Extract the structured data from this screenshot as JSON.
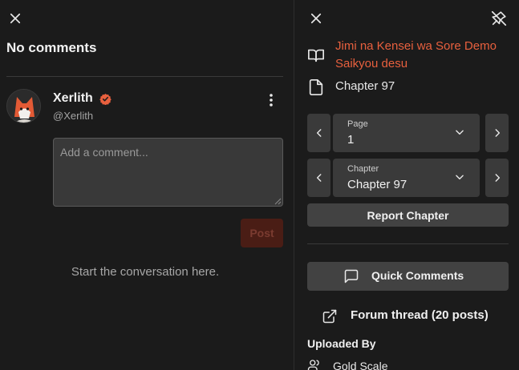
{
  "comments": {
    "heading": "No comments",
    "user": {
      "name": "Xerlith",
      "handle": "@Xerlith"
    },
    "input_placeholder": "Add a comment...",
    "post_label": "Post",
    "empty_message": "Start the conversation here."
  },
  "reader": {
    "manga_title": "Jimi na Kensei wa Sore Demo Saikyou desu",
    "chapter_label": "Chapter 97",
    "page_select": {
      "caption": "Page",
      "value": "1"
    },
    "chapter_select": {
      "caption": "Chapter",
      "value": "Chapter 97"
    },
    "report_label": "Report Chapter",
    "quick_comments_label": "Quick Comments",
    "forum_label": "Forum thread (20 posts)",
    "uploaded_by_label": "Uploaded By",
    "group_name": "Gold Scale"
  },
  "colors": {
    "accent": "#e8603e",
    "background": "#1b1b1b",
    "control": "#3a3a3a"
  },
  "icons": [
    "close-icon",
    "pin-off-icon",
    "kebab-menu-icon",
    "verified-badge-icon",
    "book-icon",
    "file-icon",
    "chevron-left-icon",
    "chevron-right-icon",
    "chevron-down-icon",
    "message-square-icon",
    "external-link-icon",
    "users-icon"
  ]
}
